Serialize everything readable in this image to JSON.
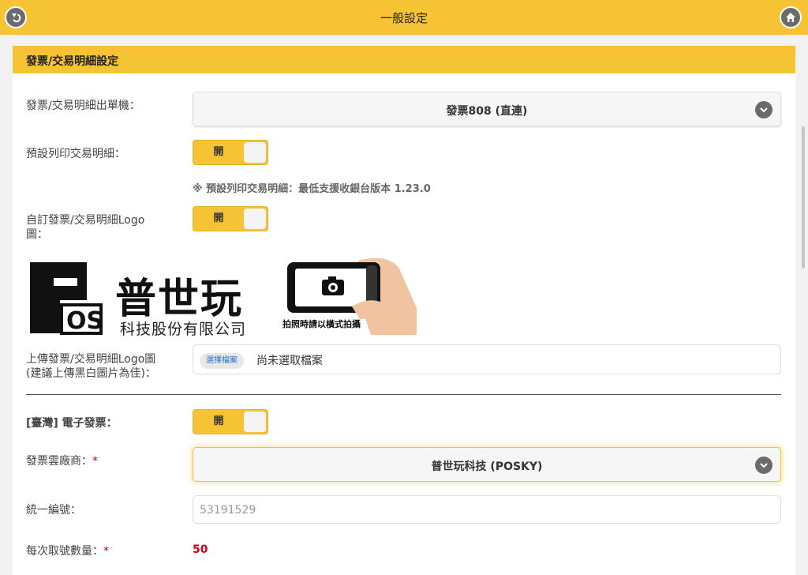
{
  "header": {
    "title": "一般設定",
    "back_icon": "back-arrow-icon",
    "home_icon": "home-icon"
  },
  "section": {
    "title": "發票/交易明細設定"
  },
  "printer": {
    "label": "發票/交易明細出單機：",
    "value": "發票808 (直連)"
  },
  "default_print": {
    "label": "預設列印交易明細：",
    "toggle_label": "開",
    "note": "※ 預設列印交易明細：最低支援收銀台版本 1.23.0"
  },
  "custom_logo": {
    "label_line1": "自訂發票/交易明細Logo",
    "label_line2": "圖：",
    "toggle_label": "開"
  },
  "logo_preview": {
    "brand_title": "普世玩",
    "brand_subtitle": "科技股份有限公司",
    "photo_hint": "拍照時請以橫式拍攝"
  },
  "upload": {
    "label_line1": "上傳發票/交易明細Logo圖",
    "label_line2": "(建議上傳黑白圖片為佳)：",
    "button_label": "選擇檔案",
    "status": "尚未選取檔案"
  },
  "einvoice": {
    "label": "[臺灣] 電子發票：",
    "toggle_label": "開"
  },
  "vendor": {
    "label": "發票雲廠商：",
    "required_mark": "*",
    "value": "普世玩科技 (POSKY)"
  },
  "tax_id": {
    "label": "統一編號：",
    "value": "53191529"
  },
  "number_count": {
    "label": "每次取號數量：",
    "required_mark": "*",
    "value": "50"
  },
  "colors": {
    "accent": "#f5c333",
    "required": "#d0021b"
  }
}
